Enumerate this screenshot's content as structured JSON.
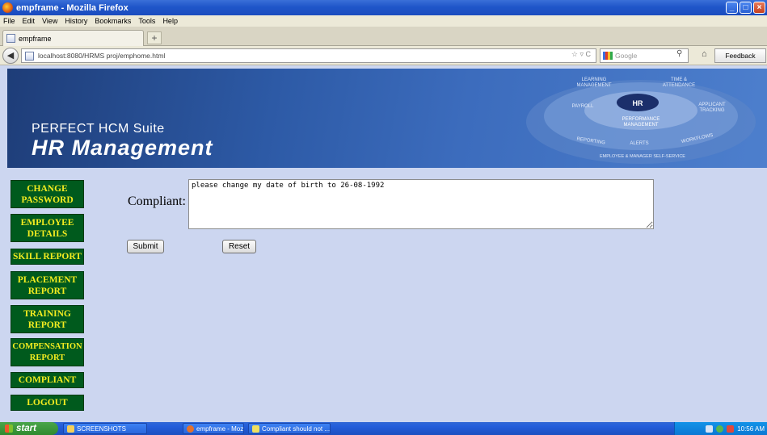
{
  "window": {
    "title": "empframe - Mozilla Firefox",
    "controls": [
      "_",
      "□",
      "×"
    ]
  },
  "menubar": [
    "File",
    "Edit",
    "View",
    "History",
    "Bookmarks",
    "Tools",
    "Help"
  ],
  "tab": {
    "label": "empframe",
    "new_tab": "+"
  },
  "navbar": {
    "url": "localhost:8080/HRMS proj/emphome.html",
    "url_tools": "☆ ▿ C",
    "search_placeholder": "Google",
    "feedback": "Feedback"
  },
  "banner": {
    "subtitle": "PERFECT HCM Suite",
    "title": "HR Management",
    "wheel": {
      "center": "HR",
      "learning": [
        "LEARNING",
        "MANAGEMENT"
      ],
      "time": [
        "TIME &",
        "ATTENDANCE"
      ],
      "payroll": "PAYROLL",
      "applicant": [
        "APPLICANT",
        "TRACKING"
      ],
      "performance": [
        "PERFORMANCE",
        "MANAGEMENT"
      ],
      "reporting": "REPORTING",
      "alerts": "ALERTS",
      "workflows": "WORKFLOWS",
      "employee": "EMPLOYEE & MANAGER SELF-SERVICE"
    }
  },
  "sidebar": {
    "items": [
      "CHANGE\nPASSWORD",
      "EMPLOYEE\nDETAILS",
      "SKILL REPORT",
      "PLACEMENT\nREPORT",
      "TRAINING\nREPORT",
      "COMPENSATION\nREPORT",
      "COMPLIANT",
      "LOGOUT"
    ]
  },
  "form": {
    "label": "Compliant:",
    "value": "please change my date of birth to 26-08-1992",
    "submit": "Submit",
    "reset": "Reset"
  },
  "taskbar": {
    "start": "start",
    "items": [
      "SCREENSHOTS",
      "empframe - Mozilla Fir...",
      "Compliant should not ..."
    ],
    "clock": "10:56 AM"
  },
  "colors": {
    "sidebar_bg": "#005a1d",
    "sidebar_text": "#f4ed20",
    "page_bg": "#ccd6f0"
  }
}
